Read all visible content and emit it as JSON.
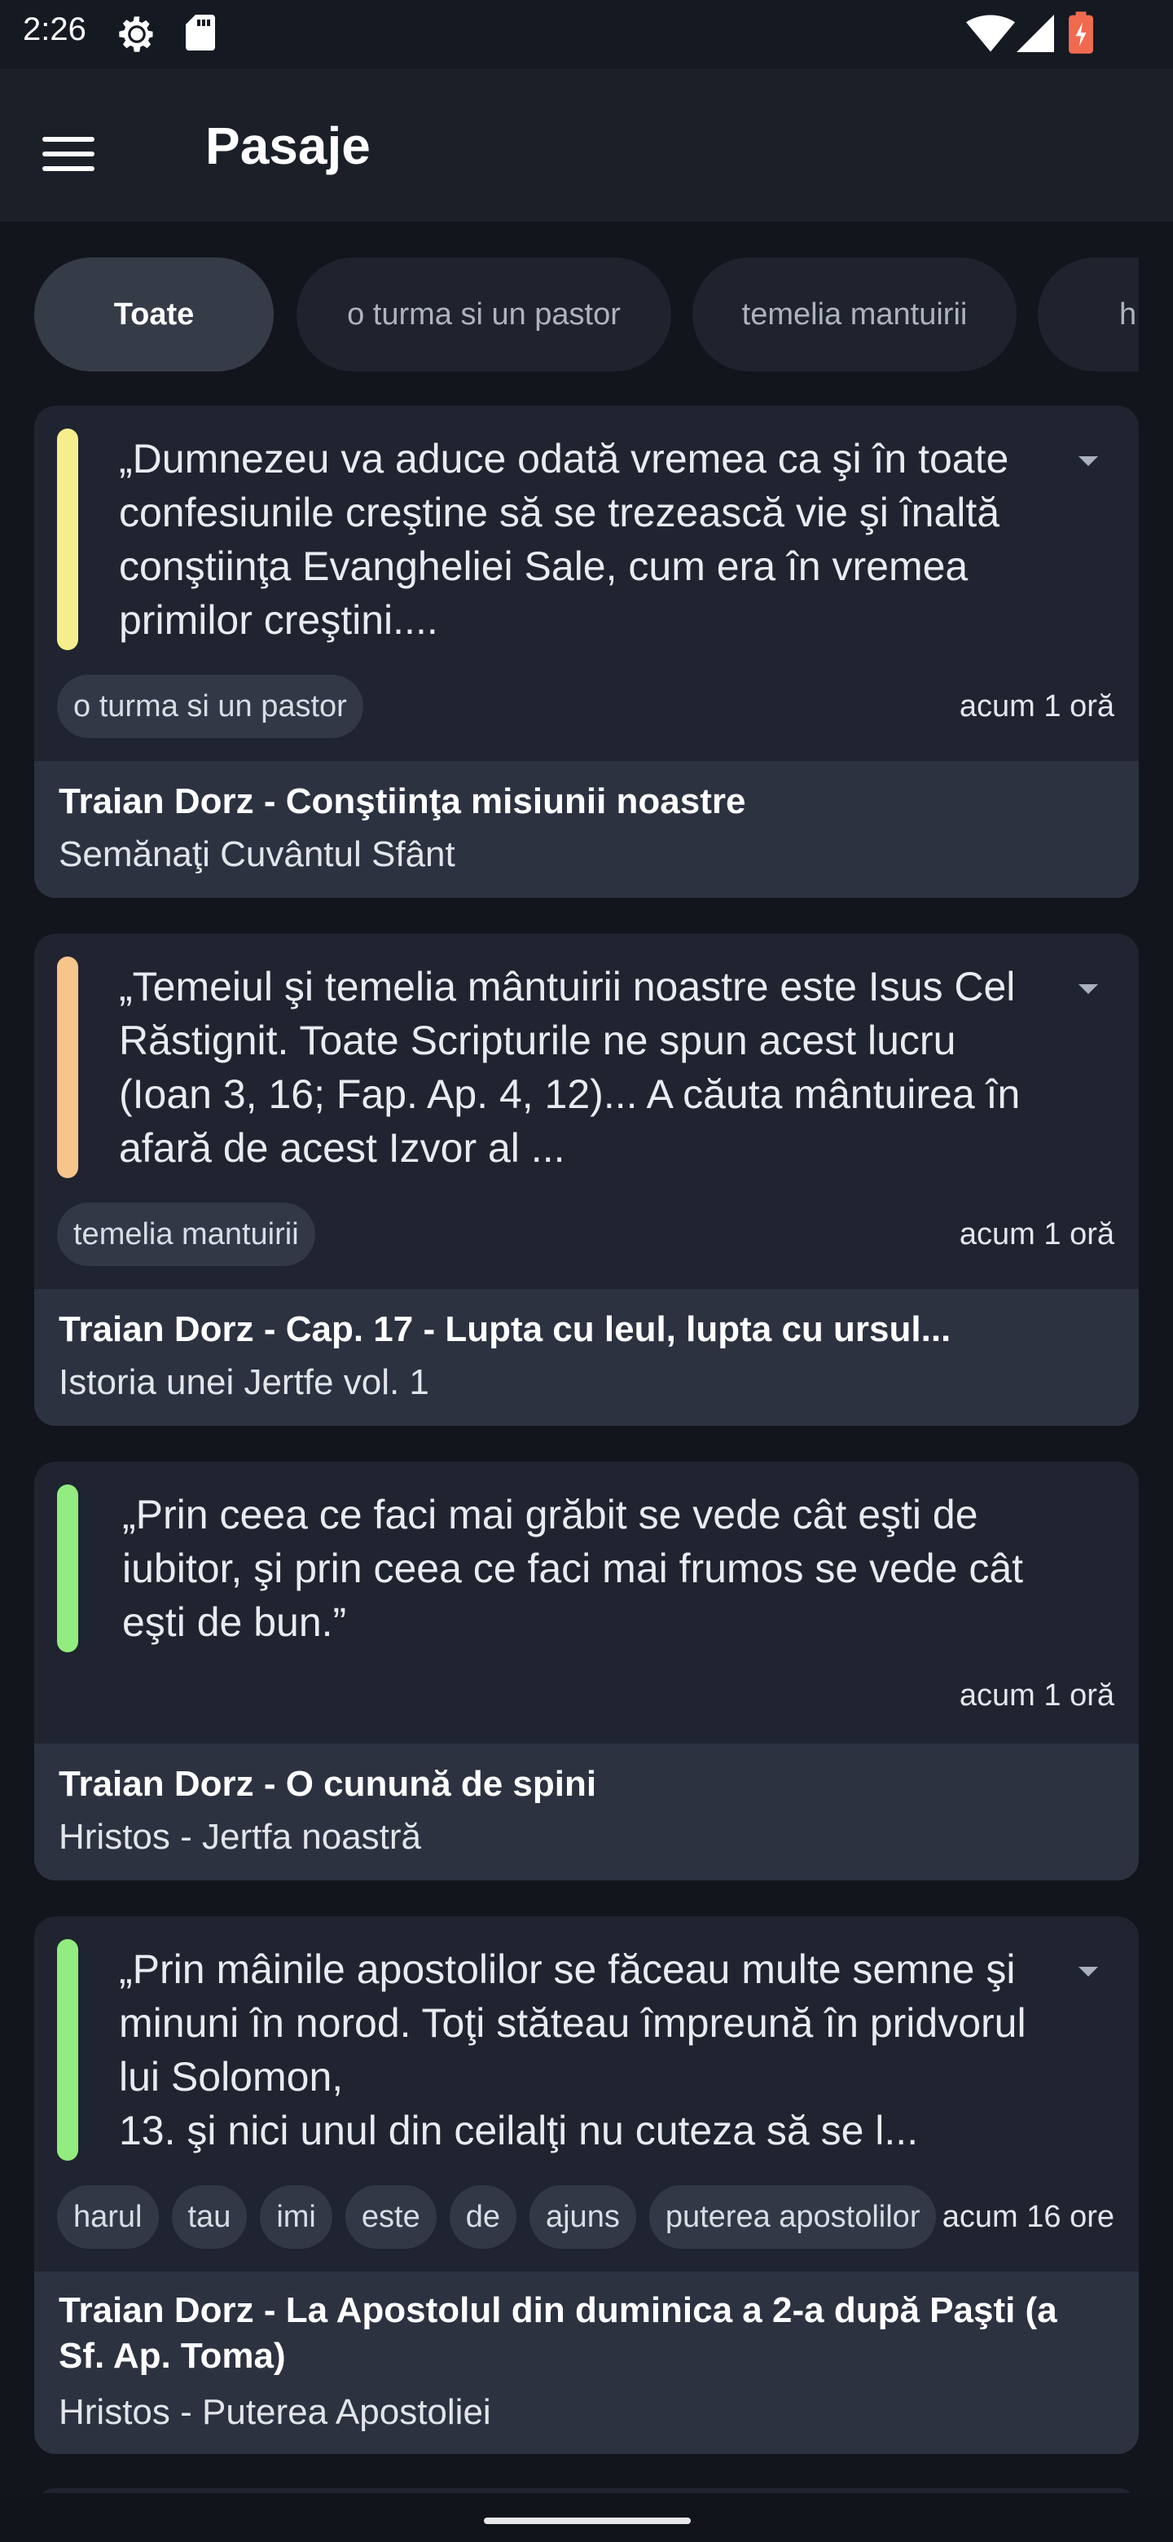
{
  "status": {
    "time": "2:26",
    "icons": [
      "settings-icon",
      "sd-card-icon",
      "wifi-icon",
      "signal-icon",
      "battery-icon"
    ]
  },
  "appbar": {
    "title": "Pasaje",
    "menu_icon": "hamburger-menu-icon"
  },
  "filters": {
    "chips": [
      {
        "label": "Toate",
        "active": true
      },
      {
        "label": "o turma si un pastor",
        "active": false
      },
      {
        "label": "temelia mantuirii",
        "active": false
      },
      {
        "label": "h",
        "active": false
      }
    ]
  },
  "cards": [
    {
      "accent_color": "#f6ee8c",
      "quote": "„Dumnezeu va aduce odată vremea ca şi în toate confesiunile creştine să se trezească vie şi înaltă conştiinţa Evangheliei Sale, cum era în vremea primilor creştini....",
      "tags": [
        "o turma si un pastor"
      ],
      "time": "acum 1 oră",
      "title": "Traian Dorz - Conştiinţa misiunii noastre",
      "subtitle": "Semănaţi Cuvântul Sfânt"
    },
    {
      "accent_color": "#f7c48b",
      "quote": "„Temeiul şi temelia mântuirii noastre este Isus Cel Răstignit. Toate Scripturile ne spun acest lucru (Ioan 3, 16; Fap. Ap. 4, 12)... A căuta mântuirea în afară de acest Izvor al ...",
      "tags": [
        "temelia mantuirii"
      ],
      "time": "acum 1 oră",
      "title": "Traian Dorz - Cap. 17 - Lupta cu leul, lupta cu ursul...",
      "subtitle": "Istoria unei Jertfe vol. 1"
    },
    {
      "accent_color": "#93ec7f",
      "quote": "„Prin ceea ce faci mai grăbit se vede cât eşti de iubitor, şi prin ceea ce faci mai frumos se vede cât eşti de bun.”",
      "tags": [],
      "time": "acum 1 oră",
      "title": "Traian Dorz - O cunună de spini",
      "subtitle": "Hristos - Jertfa noastră"
    },
    {
      "accent_color": "#93ec7f",
      "quote": "„Prin mâinile apostolilor se făceau multe semne şi minuni în norod. Toţi stăteau împreună în pridvorul lui Solomon,\n13. şi nici unul din ceilalţi nu cuteza să se l...",
      "tags": [
        "harul",
        "tau",
        "imi",
        "este",
        "de",
        "ajuns",
        "puterea apostolilor"
      ],
      "time": "acum 16 ore",
      "title": "Traian Dorz - La Apostolul din duminica a 2-a după Paşti (a Sf. Ap. Toma)",
      "subtitle": "Hristos - Puterea Apostoliei"
    }
  ]
}
